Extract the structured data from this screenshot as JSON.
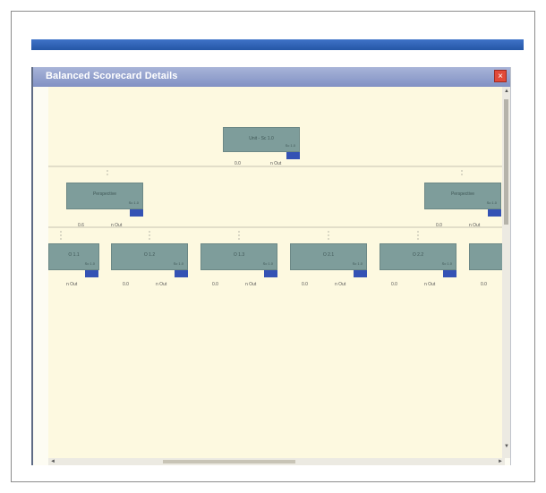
{
  "dialog": {
    "title": "Balanced Scorecard Details",
    "close_symbol": "×"
  },
  "tree": {
    "root": {
      "label": "Unit - Sc 1.0",
      "sub": "Sc 1.0",
      "left_value": "0.0",
      "right_value": "n Out"
    },
    "level1": [
      {
        "label": "Perspective",
        "sub": "Sc 1.0",
        "left_value": "0.6",
        "right_value": "n Out"
      },
      {
        "label": "Perspective",
        "sub": "Sc 1.0",
        "left_value": "0.0",
        "right_value": "n Out"
      }
    ],
    "level2": [
      {
        "label": "O 1.1",
        "sub": "Sc 1.0",
        "left_value": "",
        "right_value": "n Out"
      },
      {
        "label": "O 1.2",
        "sub": "Sc 1.0",
        "left_value": "0.0",
        "right_value": "n Out"
      },
      {
        "label": "O 1.3",
        "sub": "Sc 1.0",
        "left_value": "0.0",
        "right_value": "n Out"
      },
      {
        "label": "O 2.1",
        "sub": "Sc 1.0",
        "left_value": "0.0",
        "right_value": "n Out"
      },
      {
        "label": "O 2.2",
        "sub": "Sc 1.0",
        "left_value": "0.0",
        "right_value": "n Out"
      },
      {
        "label": "O",
        "sub": "",
        "left_value": "0.0",
        "right_value": ""
      }
    ]
  },
  "colors": {
    "node_fill": "#7e9d9b",
    "flag_fill": "#3452b4",
    "canvas_bg": "#fdf9e0",
    "header_blue": "#2556a6"
  }
}
